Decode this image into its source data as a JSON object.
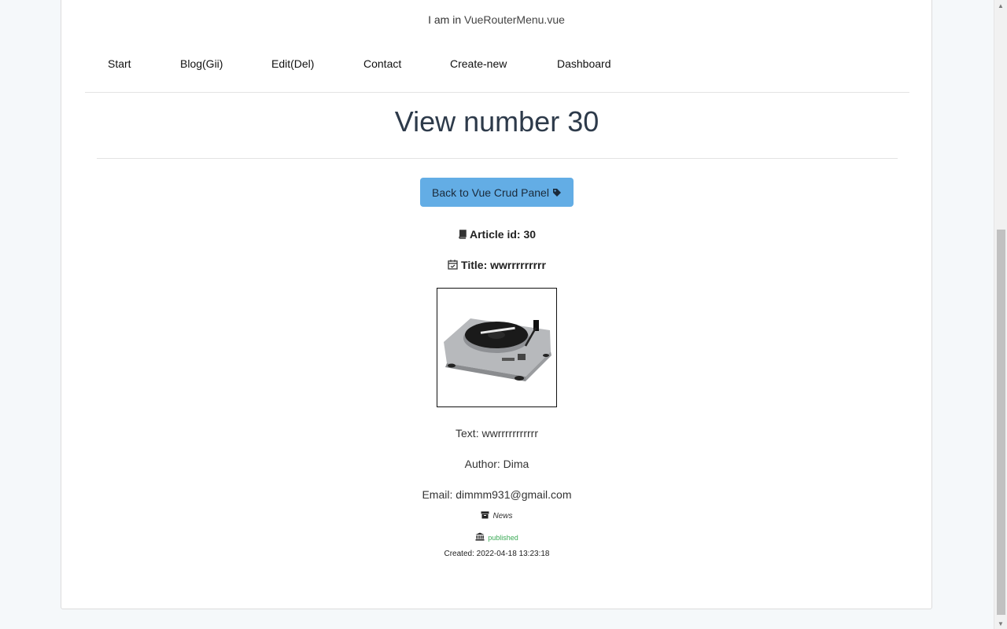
{
  "router_note": {
    "prefix": "I am in ",
    "name": "VueRouterMenu.vue"
  },
  "nav": {
    "items": [
      {
        "label": "Start"
      },
      {
        "label": "Blog(Gii)"
      },
      {
        "label": "Edit(Del)"
      },
      {
        "label": "Contact"
      },
      {
        "label": "Create-new"
      },
      {
        "label": "Dashboard"
      }
    ]
  },
  "page": {
    "title": "View number 30",
    "back_button": "Back to Vue Crud Panel",
    "article_id_label": "Article id: 30",
    "title_label": "Title: wwrrrrrrrrr",
    "text_label": "Text: wwrrrrrrrrrrr",
    "author_label": "Author: Dima",
    "email_label": "Email: dimmm931@gmail.com",
    "category": "News",
    "status": "published",
    "created": "Created: 2022-04-18 13:23:18"
  },
  "icons": {
    "back_button": "tag-icon",
    "article_id": "book-icon",
    "title": "calendar-check-icon",
    "category": "archive-icon",
    "status": "bank-icon",
    "image": "turntable-image"
  },
  "colors": {
    "button_bg": "#63ade5",
    "status_text": "#3aaa55",
    "title_text": "#2d3a4a"
  }
}
